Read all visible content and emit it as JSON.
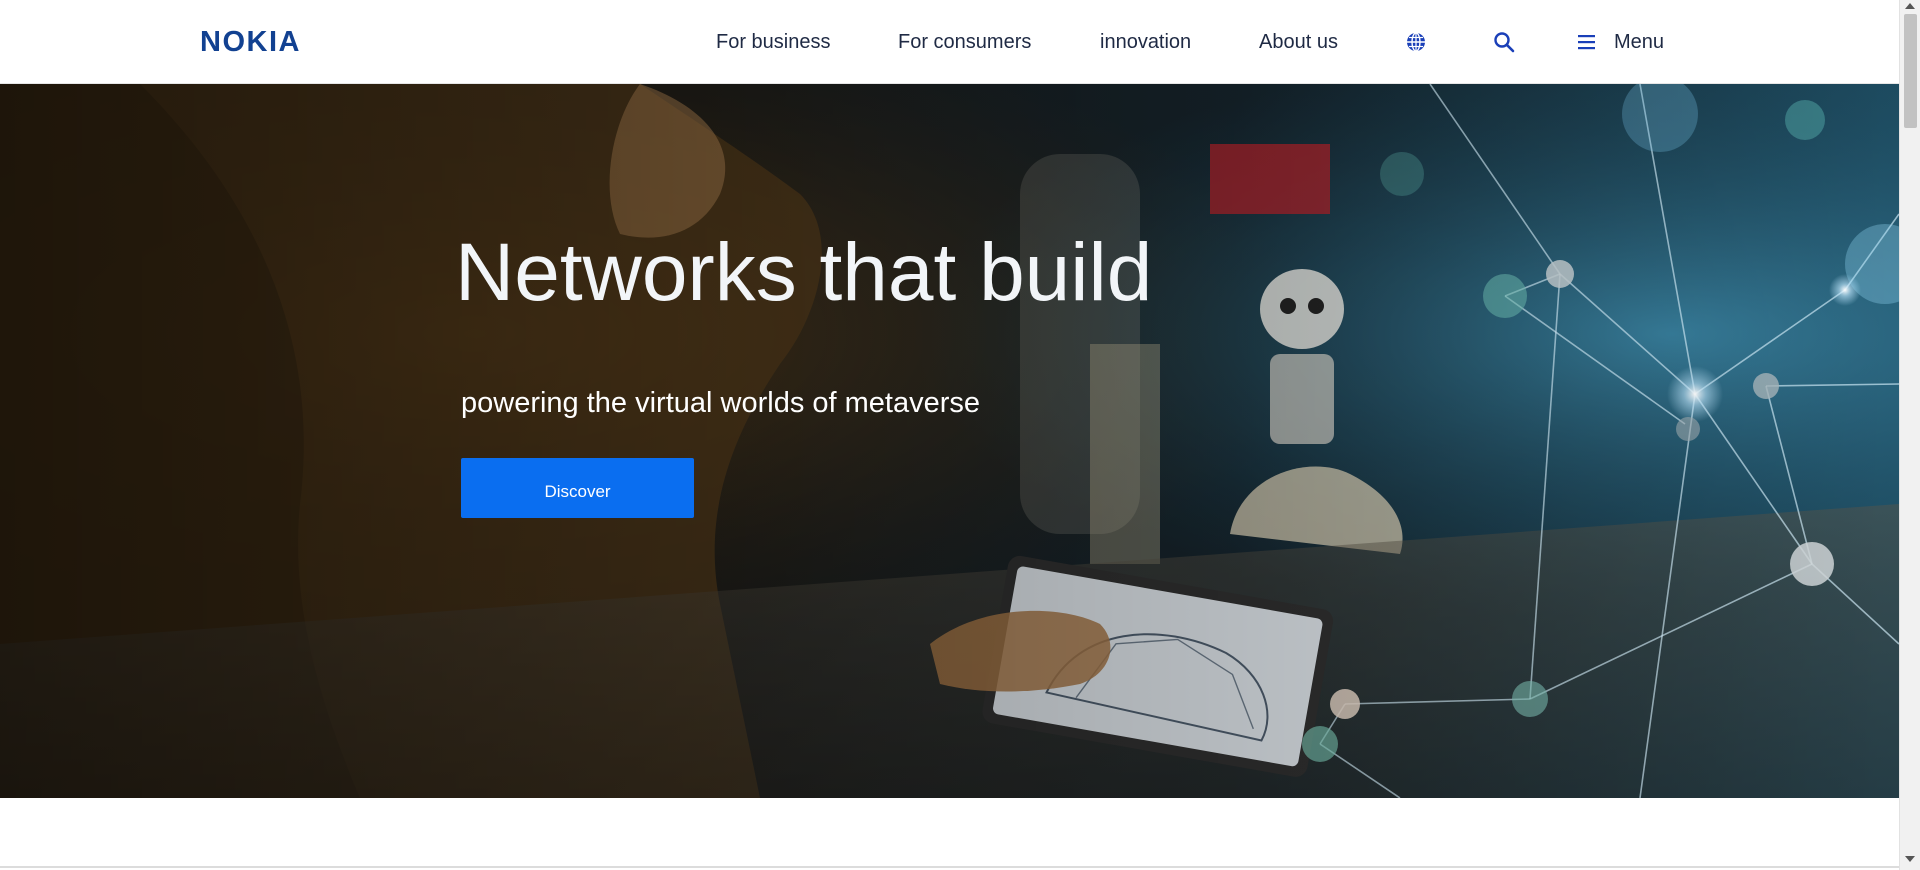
{
  "header": {
    "logo_text": "NOKIA",
    "nav": {
      "for_business": "For business",
      "for_consumers": "For consumers",
      "innovation": "innovation",
      "about_us": "About us",
      "globe_icon": "globe-icon",
      "search_icon": "search-icon",
      "menu_icon": "hamburger-menu-icon",
      "menu_label": "Menu"
    }
  },
  "hero": {
    "title": "Networks that build",
    "subtitle": "powering the virtual worlds of metaverse",
    "cta_label": "Discover"
  },
  "colors": {
    "brand_blue": "#124191",
    "cta_blue": "#0A6EF0",
    "icon_blue": "#1A3FB8",
    "nav_text": "#1F2A44"
  }
}
